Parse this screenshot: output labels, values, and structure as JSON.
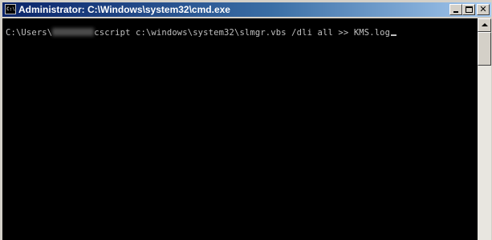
{
  "window": {
    "title": "Administrator: C:\\Windows\\system32\\cmd.exe",
    "icon": "cmd-icon",
    "icon_text": "C:\\"
  },
  "titlebar_buttons": {
    "minimize": "minimize-icon",
    "maximize": "maximize-icon",
    "close": "close-icon",
    "close_glyph": "✕"
  },
  "console": {
    "prompt_prefix": "C:\\Users\\",
    "command": "cscript c:\\windows\\system32\\slmgr.vbs /dli all >> KMS.log",
    "username_redacted": true
  },
  "colors": {
    "console_background": "#000000",
    "console_text": "#c0c0c0",
    "titlebar_start": "#0a246a",
    "titlebar_end": "#a6caf0"
  }
}
